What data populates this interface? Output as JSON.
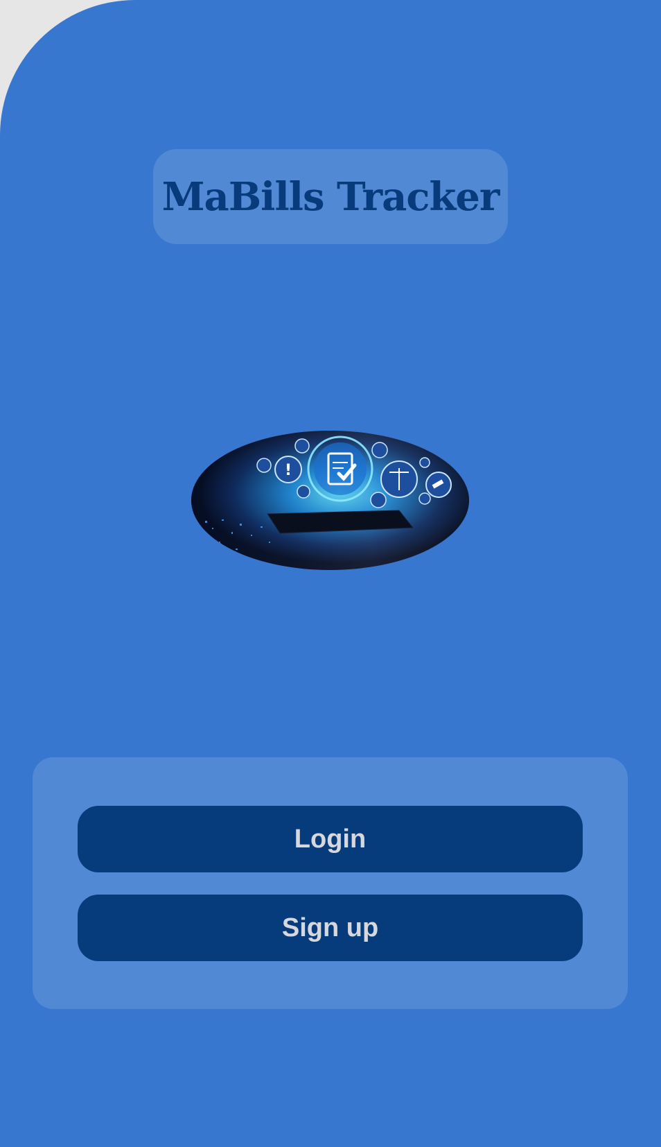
{
  "app": {
    "title": "MaBills Tracker"
  },
  "hero": {
    "icon": "compliance-checklist-illustration"
  },
  "actions": {
    "login_label": "Login",
    "signup_label": "Sign up"
  },
  "colors": {
    "background": "#3877d0",
    "panel": "#5289d5",
    "button": "#063b7c",
    "title_text": "#073b7b",
    "button_text": "#d6d8de"
  }
}
